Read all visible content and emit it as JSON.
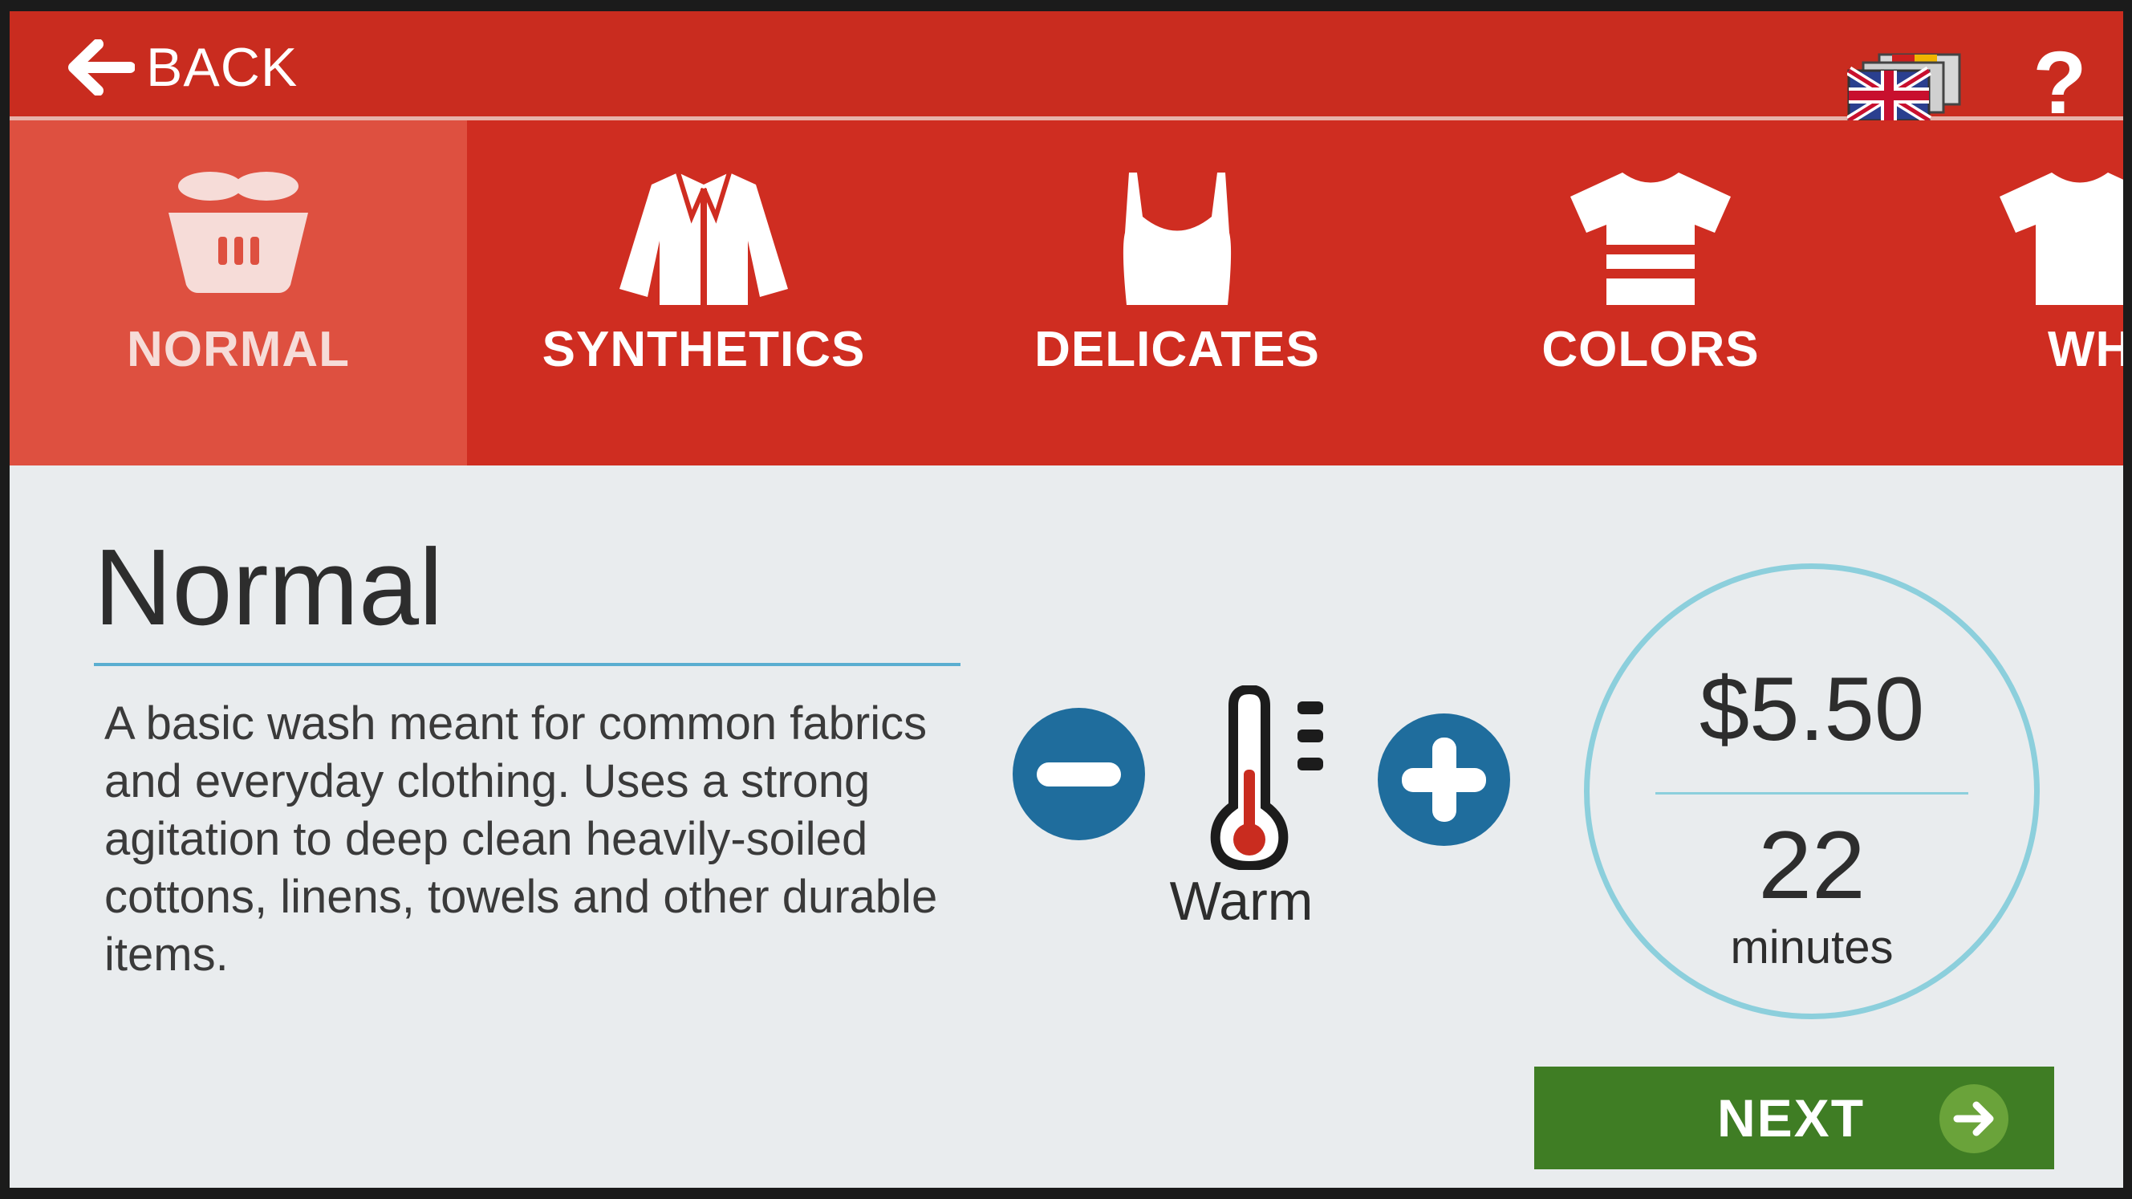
{
  "topbar": {
    "back_label": "BACK",
    "language_icon": "flags-icon",
    "help_label": "?"
  },
  "tabs": [
    {
      "label": "NORMAL",
      "icon": "basket-icon",
      "active": true
    },
    {
      "label": "SYNTHETICS",
      "icon": "jacket-icon",
      "active": false
    },
    {
      "label": "DELICATES",
      "icon": "camisole-icon",
      "active": false
    },
    {
      "label": "COLORS",
      "icon": "striped-shirt-icon",
      "active": false
    },
    {
      "label": "WHI",
      "icon": "shirt-icon",
      "active": false
    }
  ],
  "cycle": {
    "title": "Normal",
    "description": "A basic wash meant for common fabrics and everyday clothing. Uses a strong agitation to deep clean heavily-soiled cottons, linens, towels and other durable items."
  },
  "temperature": {
    "label": "Warm",
    "level_fraction": 0.5
  },
  "summary": {
    "price": "$5.50",
    "duration": "22",
    "duration_unit": "minutes"
  },
  "next": {
    "label": "NEXT"
  },
  "colors": {
    "brand_red": "#c92c1f",
    "accent_blue": "#1f6d9d",
    "next_green": "#3f7d24",
    "circle_blue": "#8ccfdc"
  }
}
